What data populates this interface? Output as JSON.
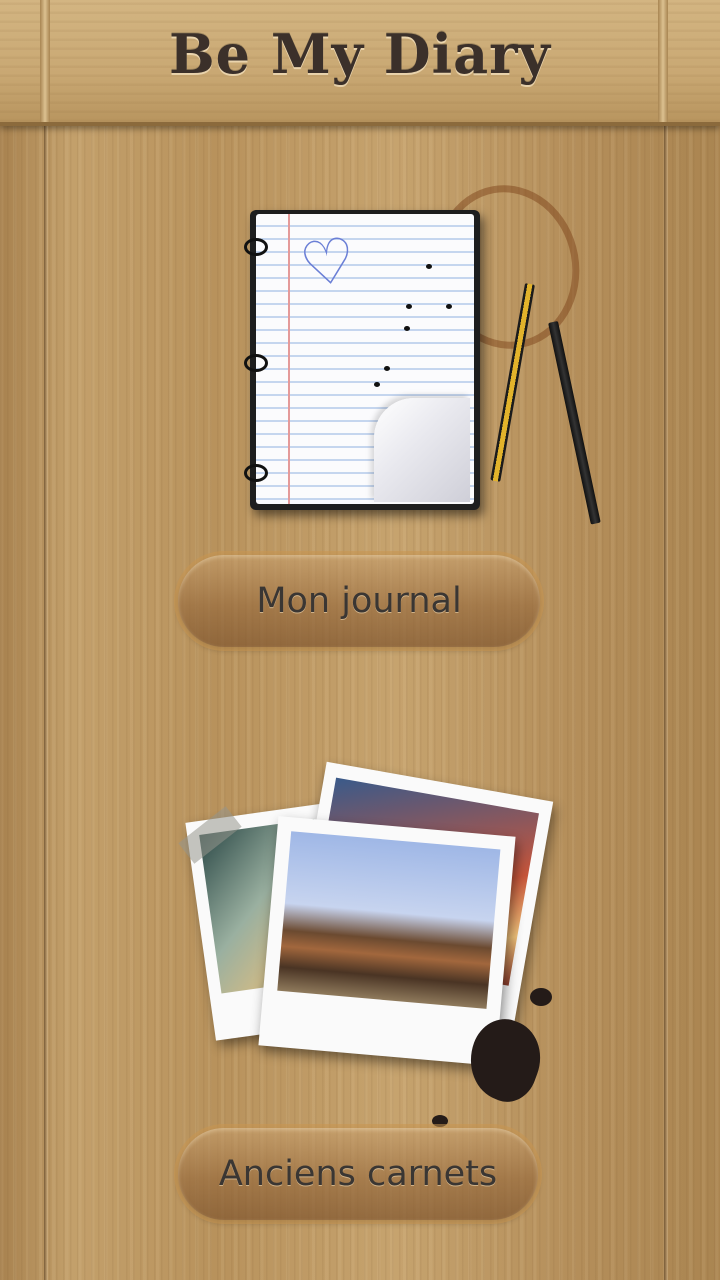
{
  "header": {
    "title": "Be My Diary"
  },
  "menu": {
    "journal_button_label": "Mon journal",
    "archives_button_label": "Anciens carnets"
  },
  "illustrations": {
    "journal_icon": "notebook-icon",
    "archives_icon": "photos-icon"
  },
  "colors": {
    "wood": "#b8935f",
    "title_text": "#3b302a",
    "button_text": "#3a3633"
  }
}
